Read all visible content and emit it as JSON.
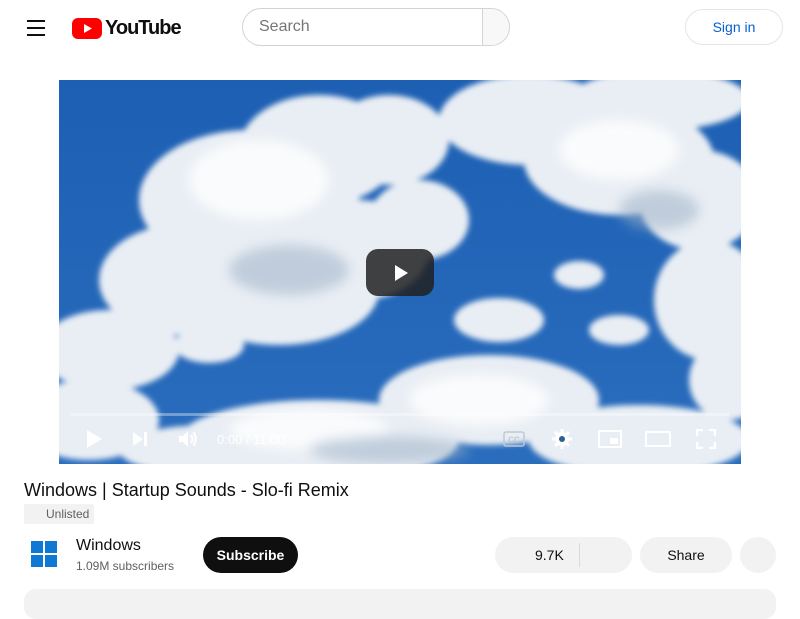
{
  "header": {
    "logo_text": "YouTube",
    "search_placeholder": "Search",
    "signin_label": "Sign in"
  },
  "player": {
    "current_time": "0:00",
    "duration": "11:00",
    "time_display": "0:00 / 11:00",
    "progress": 0,
    "controls": [
      "play-icon",
      "next-icon",
      "volume-icon",
      "cc-icon",
      "settings-icon",
      "miniplayer-icon",
      "theater-icon",
      "fullscreen-icon"
    ]
  },
  "video": {
    "title": "Windows | Startup Sounds - Slo-fi Remix",
    "visibility_badge": "Unlisted"
  },
  "channel": {
    "name": "Windows",
    "subscribers": "1.09M subscribers",
    "subscribe_label": "Subscribe"
  },
  "actions": {
    "like_count": "9.7K",
    "share_label": "Share"
  },
  "colors": {
    "brand_red": "#ff0000",
    "link_blue": "#065fd4",
    "sky_blue": "#1f5fb0",
    "windows_blue": "#0f78d4"
  }
}
